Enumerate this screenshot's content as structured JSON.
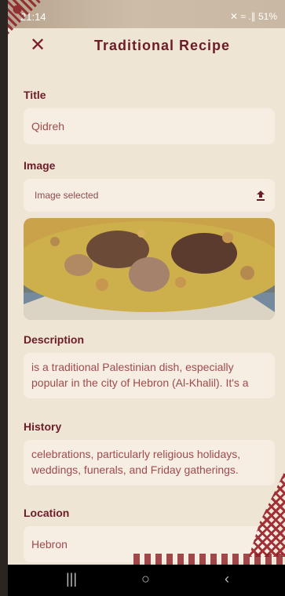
{
  "status_bar": {
    "time": "21:14",
    "icons": "✕︎ ≈ .∥ 51%"
  },
  "header": {
    "title": "Traditional Recipe",
    "close_icon": "close-icon"
  },
  "form": {
    "title_label": "Title",
    "title_value": "Qidreh",
    "image_label": "Image",
    "image_status": "Image selected",
    "description_label": "Description",
    "description_value": "is a traditional Palestinian dish, especially popular in the city of Hebron (Al-Khalil). It's a",
    "history_label": "History",
    "history_value": "celebrations, particularly religious holidays, weddings, funerals, and Friday gatherings.",
    "location_label": "Location",
    "location_value": "Hebron"
  },
  "nav": {
    "recents": "|||",
    "home": "○",
    "back": "‹"
  },
  "colors": {
    "accent": "#6e1b28",
    "field_bg": "#f6eee2",
    "page_bg": "#efe5d5"
  }
}
